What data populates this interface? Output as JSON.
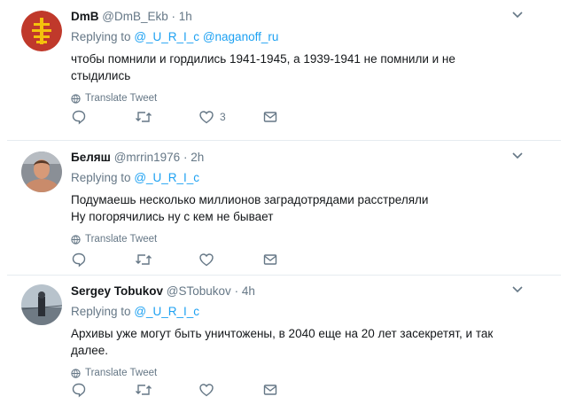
{
  "tweets": [
    {
      "name": "DmB",
      "handle": "@DmB_Ekb",
      "time": "1h",
      "replying_prefix": "Replying to",
      "mentions": [
        "@_U_R_I_c",
        "@naganoff_ru"
      ],
      "lines": [
        "чтобы помнили и гордились 1941-1945, а 1939-1941 не помнили и не",
        "стыдились"
      ],
      "translate": "Translate Tweet",
      "likes": "3"
    },
    {
      "name": "Беляш",
      "handle": "@mrrin1976",
      "time": "2h",
      "replying_prefix": "Replying to",
      "mentions": [
        "@_U_R_I_c"
      ],
      "lines": [
        "Подумаешь несколько миллионов заградотрядами расстреляли",
        "Ну погорячились ну с кем не бывает"
      ],
      "translate": "Translate Tweet",
      "likes": ""
    },
    {
      "name": "Sergey Tobukov",
      "handle": "@STobukov",
      "time": "4h",
      "replying_prefix": "Replying to",
      "mentions": [
        "@_U_R_I_c"
      ],
      "lines": [
        "Архивы уже могут быть уничтожены, в 2040 еще на 20 лет засекретят, и так",
        "далее."
      ],
      "translate": "Translate Tweet",
      "likes": ""
    }
  ],
  "separator": "·",
  "colors": {
    "link": "#1da1f2",
    "muted": "#657786",
    "text": "#14171a",
    "divider": "#e6ecf0"
  },
  "icons": [
    "reply-icon",
    "retweet-icon",
    "like-icon",
    "message-icon",
    "globe-icon",
    "chevron-down-icon"
  ]
}
